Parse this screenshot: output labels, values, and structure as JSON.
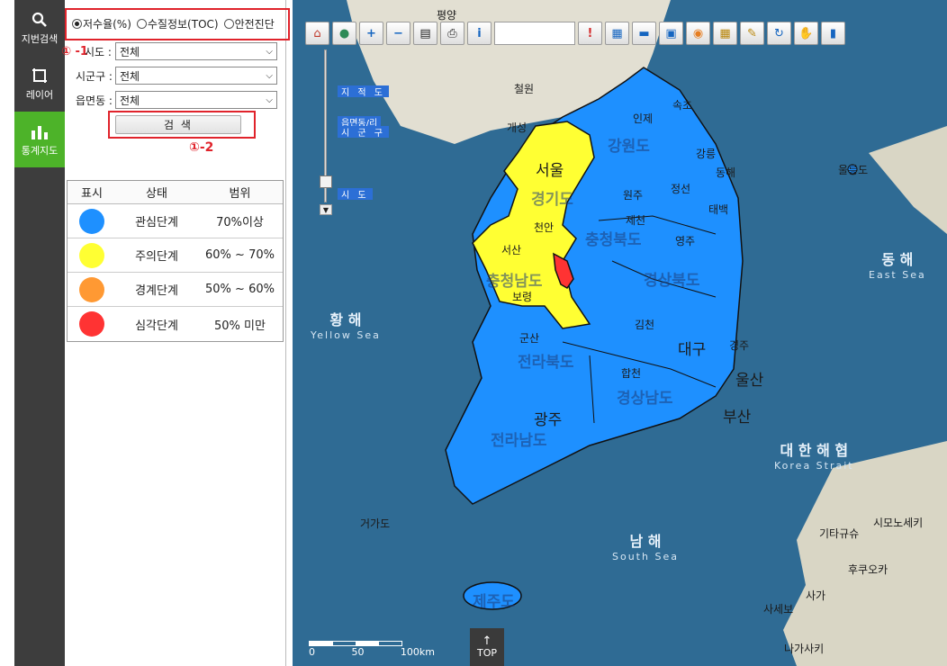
{
  "nav": [
    {
      "label": "지번검색",
      "icon": "search-icon",
      "active": false
    },
    {
      "label": "레이어",
      "icon": "layer-icon",
      "active": false
    },
    {
      "label": "통계지도",
      "icon": "bar-chart-icon",
      "active": true
    }
  ],
  "panel": {
    "radios": [
      {
        "label": "저수율(%)",
        "checked": true
      },
      {
        "label": "수질정보(TOC)",
        "checked": false
      },
      {
        "label": "안전진단",
        "checked": false
      }
    ],
    "annotations": {
      "a1": "① -1",
      "a2": "①-2"
    },
    "filters": [
      {
        "label": "시도 :",
        "value": "전체"
      },
      {
        "label": "시군구 :",
        "value": "전체"
      },
      {
        "label": "읍면동 :",
        "value": "전체"
      }
    ],
    "search_label": "검 색",
    "legend": {
      "headers": [
        "표시",
        "상태",
        "범위"
      ],
      "rows": [
        {
          "color": "#1e90ff",
          "status": "관심단계",
          "range": "70%이상"
        },
        {
          "color": "#ffff33",
          "status": "주의단계",
          "range": "60% ~ 70%"
        },
        {
          "color": "#ff9933",
          "status": "경계단계",
          "range": "50% ~ 60%"
        },
        {
          "color": "#ff3333",
          "status": "심각단계",
          "range": "50% 미만"
        }
      ]
    }
  },
  "map": {
    "zoom_tags": [
      "지 적 도",
      "읍면동/리",
      "시 군 구",
      "시 도"
    ],
    "scale": {
      "ticks": [
        "0",
        "50",
        "100km"
      ]
    },
    "top_label": "TOP",
    "seas": [
      {
        "kr": "황 해",
        "en": "Yellow Sea"
      },
      {
        "kr": "동 해",
        "en": "East Sea"
      },
      {
        "kr": "대 한 해 협",
        "en": "Korea Strait"
      },
      {
        "kr": "남 해",
        "en": "South Sea"
      }
    ],
    "cities": [
      "평양",
      "철원",
      "개성",
      "인제",
      "속초",
      "서울",
      "강릉",
      "동해",
      "원주",
      "정선",
      "태백",
      "제천",
      "영주",
      "천안",
      "서산",
      "보령",
      "군산",
      "김천",
      "대구",
      "경주",
      "울산",
      "합천",
      "부산",
      "광주",
      "거가도",
      "울릉도",
      "기타규슈",
      "시모노세키",
      "후쿠오카",
      "사가",
      "사세보",
      "나가사키"
    ],
    "provinces": [
      "강원도",
      "경기도",
      "충청북도",
      "경상북도",
      "충청남도",
      "전라북도",
      "경상남도",
      "전라남도",
      "제주도"
    ]
  }
}
